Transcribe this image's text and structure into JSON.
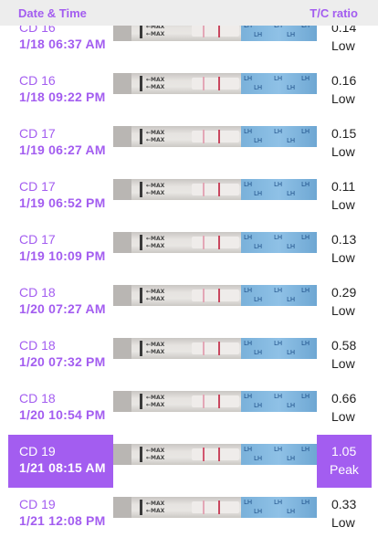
{
  "header": {
    "date_time_label": "Date & Time",
    "ratio_label": "T/C ratio"
  },
  "colors": {
    "accent": "#a35df0",
    "header_bg": "#ededed"
  },
  "strip": {
    "max_label": "←MAX",
    "lh_label": "LH"
  },
  "tests": [
    {
      "cd": "CD 16",
      "datetime": "1/18  06:37 AM",
      "ratio": "0.14",
      "status": "Low",
      "selected": false
    },
    {
      "cd": "CD 16",
      "datetime": "1/18  09:22 PM",
      "ratio": "0.16",
      "status": "Low",
      "selected": false
    },
    {
      "cd": "CD 17",
      "datetime": "1/19  06:27 AM",
      "ratio": "0.15",
      "status": "Low",
      "selected": false
    },
    {
      "cd": "CD 17",
      "datetime": "1/19  06:52 PM",
      "ratio": "0.11",
      "status": "Low",
      "selected": false
    },
    {
      "cd": "CD 17",
      "datetime": "1/19  10:09 PM",
      "ratio": "0.13",
      "status": "Low",
      "selected": false
    },
    {
      "cd": "CD 18",
      "datetime": "1/20  07:27 AM",
      "ratio": "0.29",
      "status": "Low",
      "selected": false
    },
    {
      "cd": "CD 18",
      "datetime": "1/20  07:32 PM",
      "ratio": "0.58",
      "status": "Low",
      "selected": false
    },
    {
      "cd": "CD 18",
      "datetime": "1/20  10:54 PM",
      "ratio": "0.66",
      "status": "Low",
      "selected": false
    },
    {
      "cd": "CD 19",
      "datetime": "1/21  08:15 AM",
      "ratio": "1.05",
      "status": "Peak",
      "selected": true
    },
    {
      "cd": "CD 19",
      "datetime": "1/21  12:08 PM",
      "ratio": "0.33",
      "status": "Low",
      "selected": false
    }
  ]
}
